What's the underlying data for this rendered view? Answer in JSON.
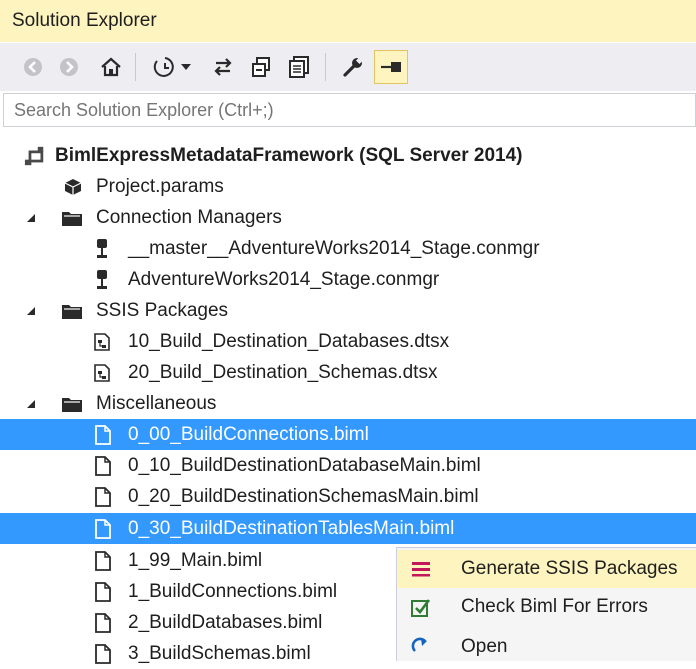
{
  "panel": {
    "title": "Solution Explorer"
  },
  "toolbar": {
    "buttons": [
      "back-icon",
      "forward-icon",
      "home-icon",
      "pending-changes-filter-icon",
      "dropdown-arrow-icon",
      "sync-icon",
      "collapse-all-icon",
      "show-all-files-icon",
      "properties-wrench-icon",
      "auto-hide-pin-icon"
    ]
  },
  "search": {
    "placeholder": "Search Solution Explorer (Ctrl+;)"
  },
  "tree": {
    "project": "BimlExpressMetadataFramework (SQL Server 2014)",
    "project_params": "Project.params",
    "connection_managers": {
      "label": "Connection Managers",
      "items": [
        "__master__AdventureWorks2014_Stage.conmgr",
        "AdventureWorks2014_Stage.conmgr"
      ]
    },
    "ssis_packages": {
      "label": "SSIS Packages",
      "items": [
        "10_Build_Destination_Databases.dtsx",
        "20_Build_Destination_Schemas.dtsx"
      ]
    },
    "miscellaneous": {
      "label": "Miscellaneous",
      "items": [
        "0_00_BuildConnections.biml",
        "0_10_BuildDestinationDatabaseMain.biml",
        "0_20_BuildDestinationSchemasMain.biml",
        "0_30_BuildDestinationTablesMain.biml",
        "1_99_Main.biml",
        "1_BuildConnections.biml",
        "2_BuildDatabases.biml",
        "3_BuildSchemas.biml"
      ]
    }
  },
  "context_menu": {
    "items": [
      {
        "label": "Generate SSIS Packages",
        "icon": "generate-ssis-icon"
      },
      {
        "label": "Check Biml For Errors",
        "icon": "check-biml-icon"
      },
      {
        "label": "Open",
        "icon": "open-icon"
      }
    ]
  },
  "colors": {
    "title_bg": "#fdf4bf",
    "selection": "#3399ff",
    "menu_highlight": "#fdf4bf",
    "toolbar_bg": "#eeeef2"
  }
}
